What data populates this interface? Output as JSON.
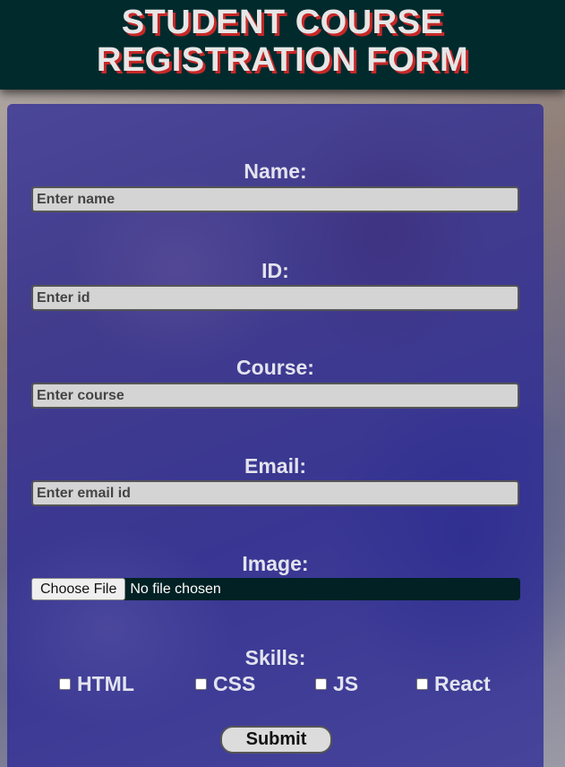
{
  "header": {
    "title_line1": "STUDENT COURSE",
    "title_line2": "REGISTRATION FORM"
  },
  "form": {
    "name": {
      "label": "Name:",
      "placeholder": "Enter name"
    },
    "id": {
      "label": "ID:",
      "placeholder": "Enter id"
    },
    "course": {
      "label": "Course:",
      "placeholder": "Enter course"
    },
    "email": {
      "label": "Email:",
      "placeholder": "Enter email id"
    },
    "image": {
      "label": "Image:",
      "button_label": "Choose File",
      "status": "No file chosen"
    },
    "skills": {
      "label": "Skills:",
      "options": [
        {
          "label": "HTML",
          "checked": false
        },
        {
          "label": "CSS",
          "checked": false
        },
        {
          "label": "JS",
          "checked": false
        },
        {
          "label": "React",
          "checked": false
        }
      ]
    },
    "submit_label": "Submit"
  },
  "colors": {
    "header_bg": "#012a2d",
    "title_text": "#e6e6e6",
    "title_shadow": "#c62828",
    "panel_bg": "#2622a0",
    "input_bg": "#d4d4d4"
  }
}
